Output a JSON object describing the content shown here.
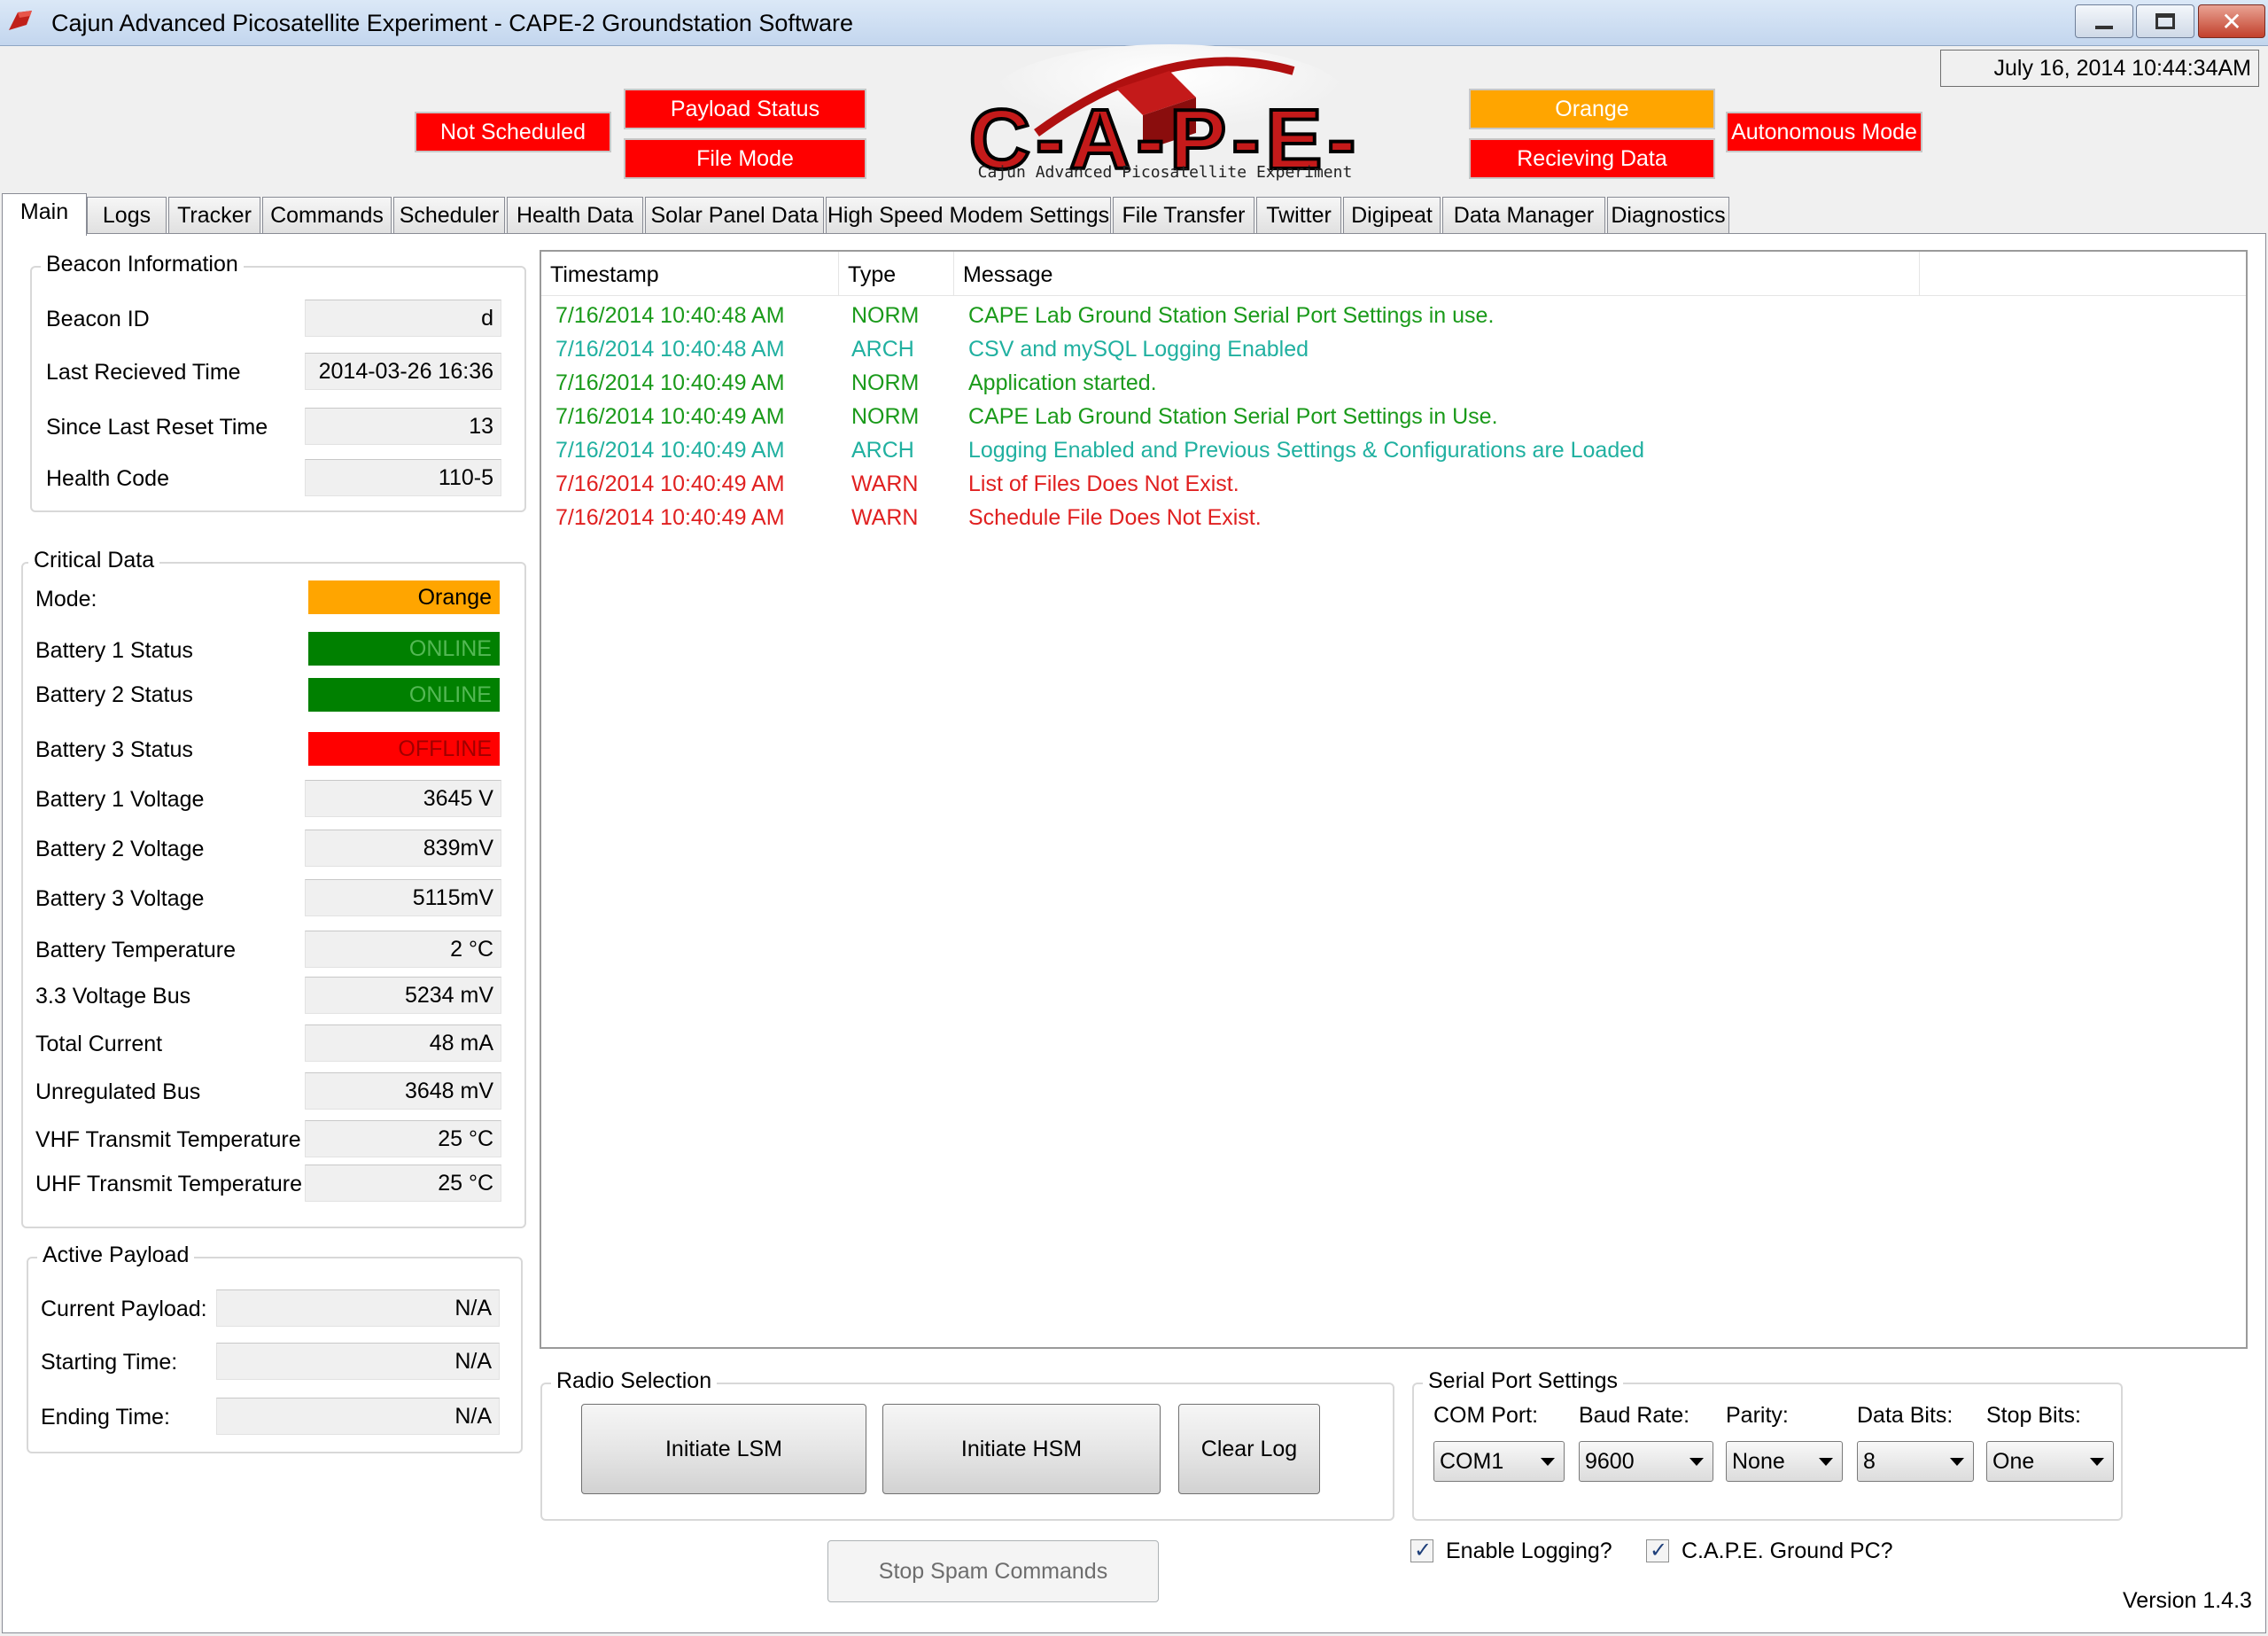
{
  "window": {
    "title": "Cajun Advanced Picosatellite Experiment - CAPE-2 Groundstation Software",
    "datetime": "July 16, 2014 10:44:34AM"
  },
  "status": {
    "not_scheduled": "Not Scheduled",
    "payload_status": "Payload Status",
    "file_mode": "File Mode",
    "mode": "Orange",
    "receiving": "Recieving Data",
    "autonomous": "Autonomous Mode"
  },
  "logo": {
    "text": "C-A-P-E-",
    "subtitle": "Cajun Advanced Picosatellite Experiment"
  },
  "tabs": [
    "Main",
    "Logs",
    "Tracker",
    "Commands",
    "Scheduler",
    "Health Data",
    "Solar Panel Data",
    "High Speed Modem Settings",
    "File Transfer",
    "Twitter",
    "Digipeat",
    "Data Manager",
    "Diagnostics"
  ],
  "beacon": {
    "title": "Beacon Information",
    "rows": [
      {
        "label": "Beacon ID",
        "value": "d"
      },
      {
        "label": "Last Recieved Time",
        "value": "2014-03-26 16:36"
      },
      {
        "label": "Since Last Reset Time",
        "value": "13"
      },
      {
        "label": "Health Code",
        "value": "110-5"
      }
    ]
  },
  "critical": {
    "title": "Critical Data",
    "rows": [
      {
        "label": "Mode:",
        "value": "Orange"
      },
      {
        "label": "Battery 1 Status",
        "value": "ONLINE"
      },
      {
        "label": "Battery 2 Status",
        "value": "ONLINE"
      },
      {
        "label": "Battery 3 Status",
        "value": "OFFLINE"
      },
      {
        "label": "Battery 1 Voltage",
        "value": "3645 V"
      },
      {
        "label": "Battery 2 Voltage",
        "value": "839mV"
      },
      {
        "label": "Battery 3 Voltage",
        "value": "5115mV"
      },
      {
        "label": "Battery Temperature",
        "value": "2 °C"
      },
      {
        "label": "3.3 Voltage Bus",
        "value": "5234 mV"
      },
      {
        "label": "Total Current",
        "value": "48 mA"
      },
      {
        "label": "Unregulated Bus",
        "value": "3648 mV"
      },
      {
        "label": "VHF Transmit Temperature",
        "value": "25 °C"
      },
      {
        "label": "UHF Transmit Temperature",
        "value": "25 °C"
      }
    ]
  },
  "payload": {
    "title": "Active Payload",
    "rows": [
      {
        "label": "Current Payload:",
        "value": "N/A"
      },
      {
        "label": "Starting Time:",
        "value": "N/A"
      },
      {
        "label": "Ending Time:",
        "value": "N/A"
      }
    ]
  },
  "log": {
    "columns": [
      "Timestamp",
      "Type",
      "Message"
    ],
    "rows": [
      {
        "timestamp": "7/16/2014 10:40:48 AM",
        "type": "NORM",
        "message": "CAPE Lab Ground Station Serial Port Settings in use."
      },
      {
        "timestamp": "7/16/2014 10:40:48 AM",
        "type": "ARCH",
        "message": "CSV and mySQL Logging Enabled"
      },
      {
        "timestamp": "7/16/2014 10:40:49 AM",
        "type": "NORM",
        "message": "Application started."
      },
      {
        "timestamp": "7/16/2014 10:40:49 AM",
        "type": "NORM",
        "message": "CAPE Lab Ground Station Serial Port Settings in Use."
      },
      {
        "timestamp": "7/16/2014 10:40:49 AM",
        "type": "ARCH",
        "message": "Logging Enabled and Previous Settings & Configurations are Loaded"
      },
      {
        "timestamp": "7/16/2014 10:40:49 AM",
        "type": "WARN",
        "message": "List of Files Does Not Exist."
      },
      {
        "timestamp": "7/16/2014 10:40:49 AM",
        "type": "WARN",
        "message": "Schedule File Does Not Exist."
      }
    ]
  },
  "radio": {
    "title": "Radio Selection",
    "lsm": "Initiate LSM",
    "hsm": "Initiate HSM",
    "clear": "Clear Log"
  },
  "serial": {
    "title": "Serial Port Settings",
    "com_label": "COM Port:",
    "com_value": "COM1",
    "baud_label": "Baud Rate:",
    "baud_value": "9600",
    "parity_label": "Parity:",
    "parity_value": "None",
    "databits_label": "Data Bits:",
    "databits_value": "8",
    "stopbits_label": "Stop Bits:",
    "stopbits_value": "One"
  },
  "stop_spam": "Stop Spam Commands",
  "checkboxes": {
    "logging": "Enable Logging?",
    "ground_pc": "C.A.P.E. Ground PC?"
  },
  "version": "Version 1.4.3",
  "colors": {
    "red": "#ff0000",
    "orange": "#ffa500",
    "green": "#008000",
    "norm": "#1a9a1a",
    "arch": "#20b0a0",
    "warn": "#e02020"
  }
}
